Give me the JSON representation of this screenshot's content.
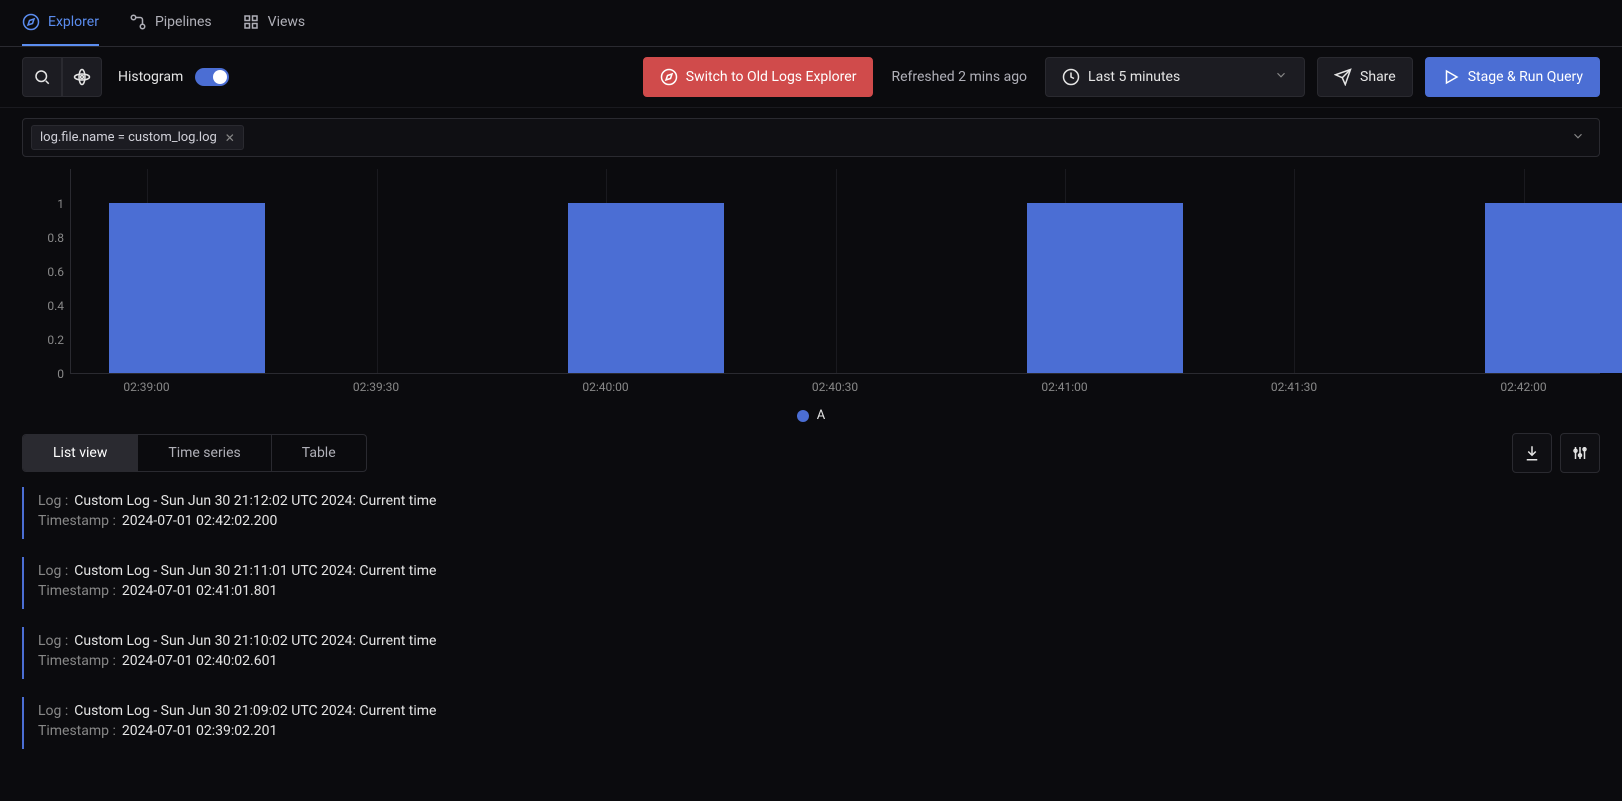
{
  "colors": {
    "accent": "#4b6ed4",
    "danger": "#d04b4b"
  },
  "tabs": {
    "explorer": "Explorer",
    "pipelines": "Pipelines",
    "views": "Views",
    "active": "explorer"
  },
  "toolbar": {
    "histogram_label": "Histogram",
    "switch_old": "Switch to Old Logs Explorer",
    "refreshed": "Refreshed 2 mins ago",
    "time_range": "Last 5 minutes",
    "share": "Share",
    "run": "Stage & Run Query"
  },
  "filter": {
    "chip": "log.file.name = custom_log.log"
  },
  "chart_data": {
    "type": "bar",
    "categories": [
      "02:39:00",
      "02:39:30",
      "02:40:00",
      "02:40:30",
      "02:41:00",
      "02:41:30",
      "02:42:00"
    ],
    "values": [
      1,
      0,
      1,
      0,
      1,
      0,
      1
    ],
    "ylim": [
      0,
      1
    ],
    "yticks": [
      0,
      0.2,
      0.4,
      0.6,
      0.8,
      1
    ],
    "legend": "A"
  },
  "view_tabs": {
    "list": "List view",
    "timeseries": "Time series",
    "table": "Table"
  },
  "log_labels": {
    "log": "Log :",
    "ts": "Timestamp :"
  },
  "logs": [
    {
      "log": "Custom Log - Sun Jun 30 21:12:02 UTC 2024: Current time",
      "ts": "2024-07-01 02:42:02.200"
    },
    {
      "log": "Custom Log - Sun Jun 30 21:11:01 UTC 2024: Current time",
      "ts": "2024-07-01 02:41:01.801"
    },
    {
      "log": "Custom Log - Sun Jun 30 21:10:02 UTC 2024: Current time",
      "ts": "2024-07-01 02:40:02.601"
    },
    {
      "log": "Custom Log - Sun Jun 30 21:09:02 UTC 2024: Current time",
      "ts": "2024-07-01 02:39:02.201"
    }
  ]
}
